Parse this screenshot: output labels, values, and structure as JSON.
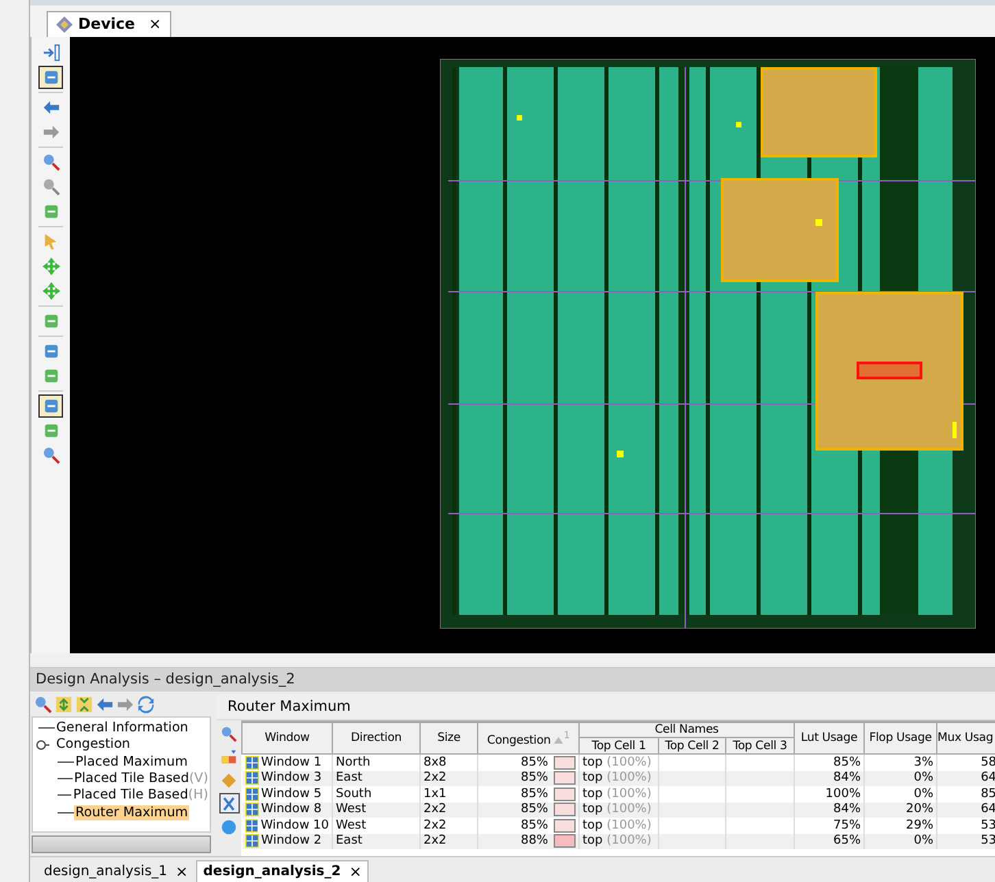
{
  "device_tab": {
    "title": "Device",
    "close": "×"
  },
  "device_toolbar": [
    {
      "pressed": false
    },
    {
      "pressed": true
    },
    {
      "pressed": false
    },
    {
      "pressed": false
    },
    {
      "pressed": false
    },
    {
      "pressed": false
    },
    {
      "pressed": false
    },
    {
      "pressed": false
    },
    {
      "pressed": false
    },
    {
      "pressed": false
    },
    {
      "pressed": false
    },
    {
      "pressed": false
    },
    {
      "pressed": false
    },
    {
      "pressed": true
    },
    {
      "pressed": false
    },
    {
      "pressed": false
    }
  ],
  "analysis_panel": {
    "title": "Design Analysis – design_analysis_2",
    "tree": [
      {
        "label": "General Information",
        "selected": false
      },
      {
        "label": "Congestion",
        "selected": false,
        "expanded": true,
        "children": [
          {
            "label": "Placed Maximum",
            "selected": false
          },
          {
            "label": "Placed Tile Based",
            "suffix": "(V)",
            "selected": false
          },
          {
            "label": "Placed Tile Based",
            "suffix": "(H)",
            "selected": false
          },
          {
            "label": "Router Maximum",
            "selected": true
          }
        ]
      }
    ],
    "view_title": "Router Maximum",
    "side_tools": [
      {
        "pressed": false
      },
      {
        "pressed": false
      },
      {
        "pressed": false
      },
      {
        "pressed": true
      },
      {
        "pressed": false
      }
    ],
    "table": {
      "columns": [
        "Window",
        "Direction",
        "Size",
        "Congestion",
        "Cell Names",
        "Lut Usage",
        "Flop Usage",
        "Mux Usag"
      ],
      "sort_index": "1",
      "subcolumns": [
        "Top Cell 1",
        "Top Cell 2",
        "Top Cell 3"
      ],
      "rows": [
        {
          "window": "Window 1",
          "direction": "North",
          "size": "8x8",
          "congestion": "85%",
          "color": "#f9dcdc",
          "cell": "top",
          "share": "(100%)",
          "lut": "85%",
          "flop": "3%",
          "mux": "58"
        },
        {
          "window": "Window 3",
          "direction": "East",
          "size": "2x2",
          "congestion": "85%",
          "color": "#f9dcdc",
          "cell": "top",
          "share": "(100%)",
          "lut": "84%",
          "flop": "0%",
          "mux": "64"
        },
        {
          "window": "Window 5",
          "direction": "South",
          "size": "1x1",
          "congestion": "85%",
          "color": "#f9dcdc",
          "cell": "top",
          "share": "(100%)",
          "lut": "100%",
          "flop": "0%",
          "mux": "85"
        },
        {
          "window": "Window 8",
          "direction": "West",
          "size": "2x2",
          "congestion": "85%",
          "color": "#f9dcdc",
          "cell": "top",
          "share": "(100%)",
          "lut": "84%",
          "flop": "20%",
          "mux": "64"
        },
        {
          "window": "Window 10",
          "direction": "West",
          "size": "2x2",
          "congestion": "85%",
          "color": "#f9dcdc",
          "cell": "top",
          "share": "(100%)",
          "lut": "75%",
          "flop": "29%",
          "mux": "53"
        },
        {
          "window": "Window 2",
          "direction": "East",
          "size": "2x2",
          "congestion": "88%",
          "color": "#f7bcbc",
          "cell": "top",
          "share": "(100%)",
          "lut": "65%",
          "flop": "0%",
          "mux": "53"
        }
      ]
    }
  },
  "bottom_tabs": [
    {
      "label": "design_analysis_1",
      "close": "×",
      "selected": false
    },
    {
      "label": "design_analysis_2",
      "close": "×",
      "selected": true
    }
  ]
}
